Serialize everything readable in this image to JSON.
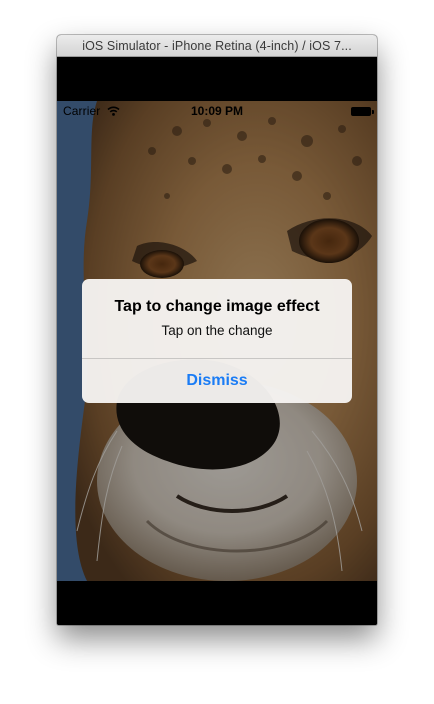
{
  "window": {
    "title": "iOS Simulator - iPhone Retina (4-inch) / iOS 7..."
  },
  "status_bar": {
    "carrier": "Carrier",
    "time": "10:09 PM"
  },
  "alert": {
    "title": "Tap to change image effect",
    "message": "Tap on the change",
    "button_label": "Dismiss"
  },
  "colors": {
    "accent": "#1a7cf5",
    "sky": "#4f74a2",
    "fur": "#b88a55"
  },
  "icons": {
    "wifi": "wifi-icon",
    "battery": "battery-icon"
  }
}
